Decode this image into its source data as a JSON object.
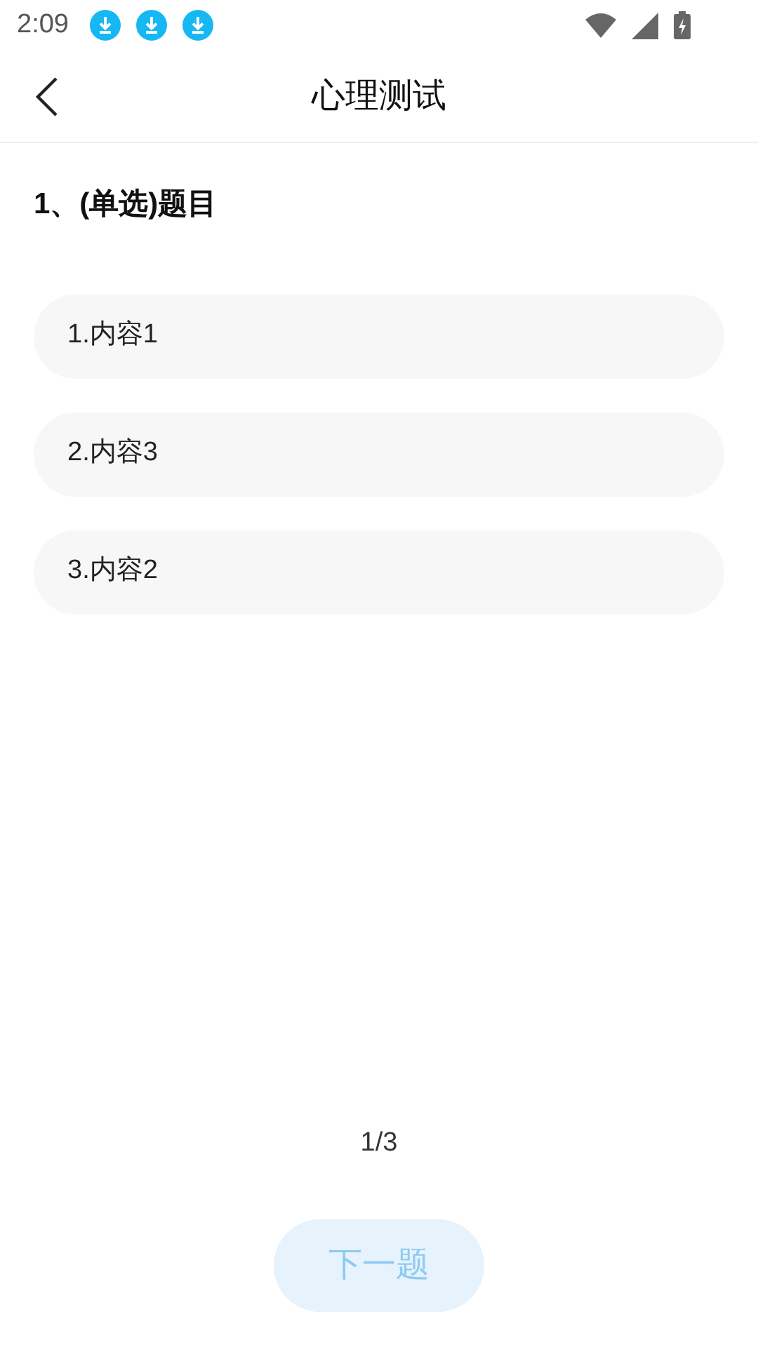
{
  "status_bar": {
    "time": "2:09",
    "notifications": [
      {
        "kind": "download"
      },
      {
        "kind": "download"
      },
      {
        "kind": "download"
      }
    ]
  },
  "header": {
    "title": "心理测试"
  },
  "question": {
    "title": "1、(单选)题目"
  },
  "options": [
    {
      "label": "1.内容1",
      "selected": false
    },
    {
      "label": "2.内容3",
      "selected": false
    },
    {
      "label": "3.内容2",
      "selected": false
    }
  ],
  "progress": "1/3",
  "next_button": {
    "label": "下一题",
    "disabled": true
  }
}
